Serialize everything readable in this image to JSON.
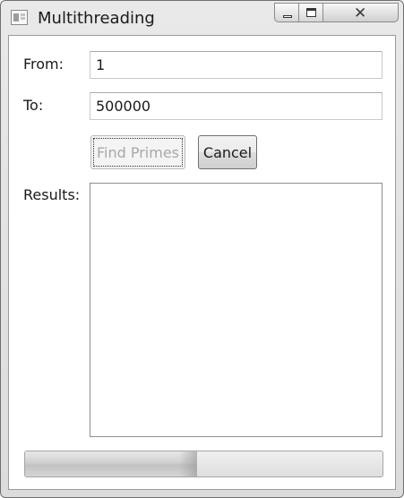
{
  "window": {
    "title": "Multithreading",
    "icon": "app-window-icon",
    "controls": {
      "minimize_icon": "minimize-icon",
      "maximize_icon": "maximize-icon",
      "close_glyph": "✕"
    }
  },
  "form": {
    "from_label": "From:",
    "from_value": "1",
    "to_label": "To:",
    "to_value": "500000",
    "find_primes_label": "Find Primes",
    "find_primes_enabled": false,
    "cancel_label": "Cancel",
    "results_label": "Results:",
    "results_text": ""
  },
  "progress": {
    "value_fraction": 0.48
  }
}
